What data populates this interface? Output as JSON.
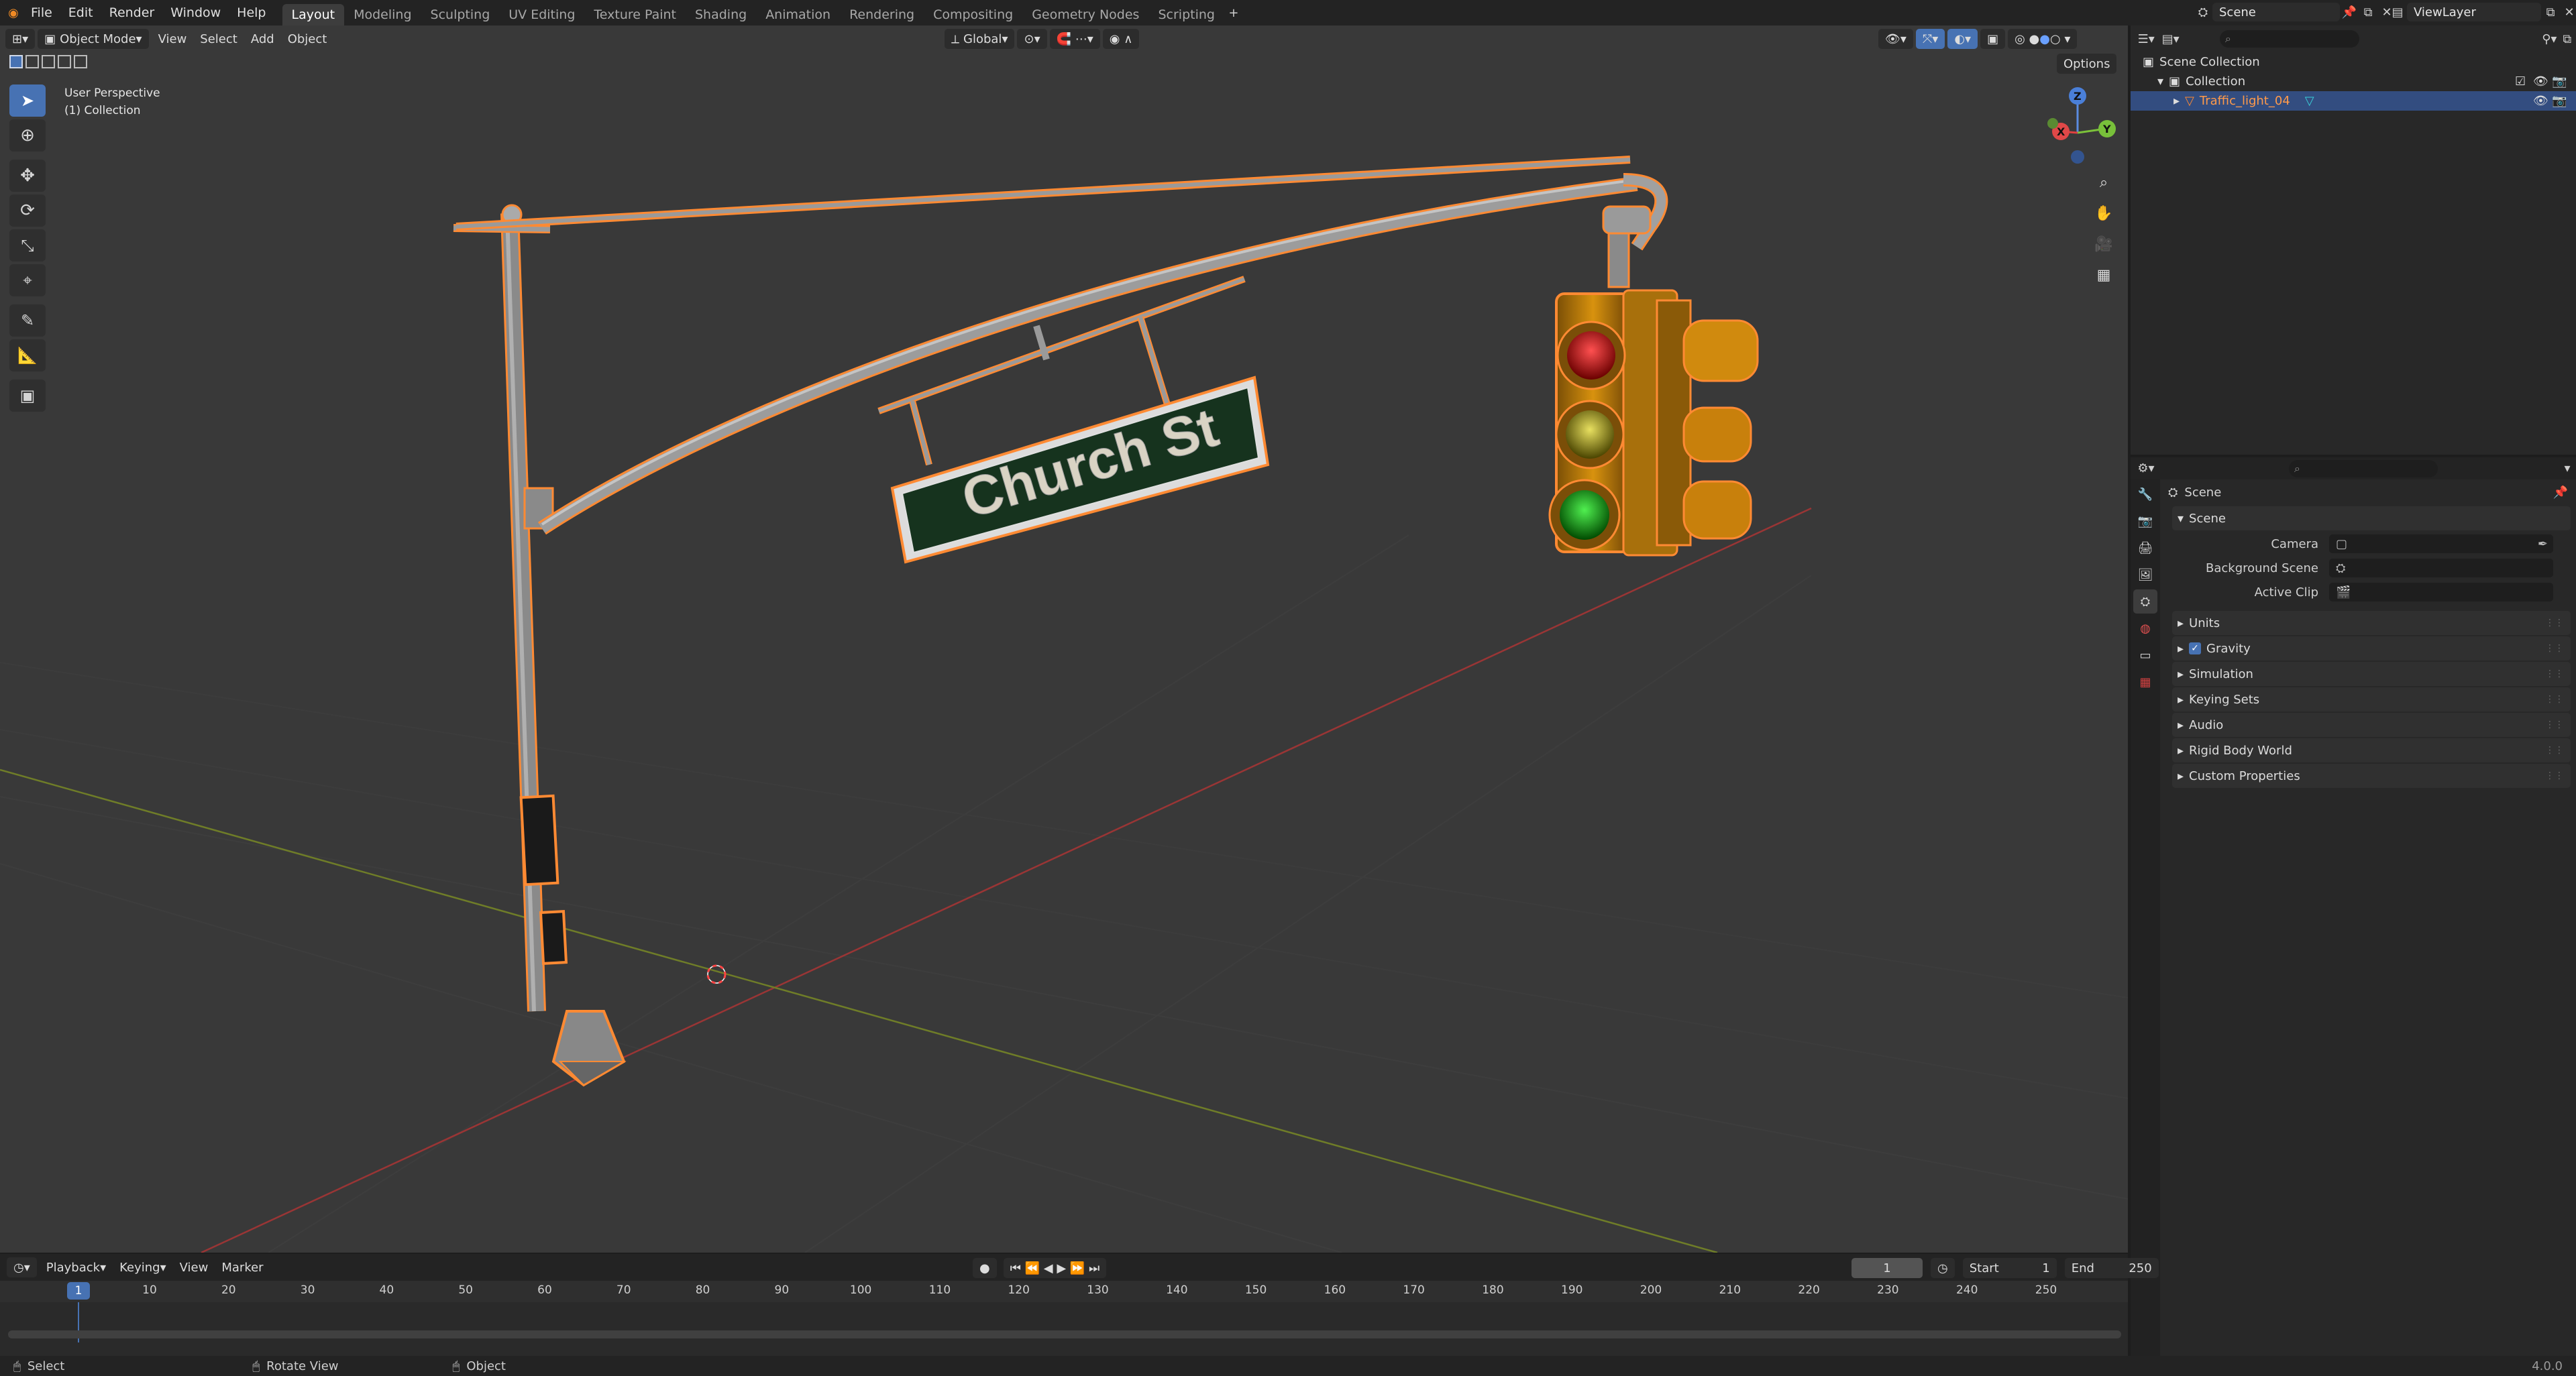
{
  "app": {
    "version": "4.0.0"
  },
  "menu": [
    "File",
    "Edit",
    "Render",
    "Window",
    "Help"
  ],
  "workspaces": [
    {
      "label": "Layout",
      "active": true
    },
    {
      "label": "Modeling"
    },
    {
      "label": "Sculpting"
    },
    {
      "label": "UV Editing"
    },
    {
      "label": "Texture Paint"
    },
    {
      "label": "Shading"
    },
    {
      "label": "Animation"
    },
    {
      "label": "Rendering"
    },
    {
      "label": "Compositing"
    },
    {
      "label": "Geometry Nodes"
    },
    {
      "label": "Scripting"
    }
  ],
  "scene_selector": {
    "value": "Scene"
  },
  "viewlayer_selector": {
    "value": "ViewLayer"
  },
  "viewport": {
    "mode": "Object Mode",
    "menus": [
      "View",
      "Select",
      "Add",
      "Object"
    ],
    "transform_orientation": "Global",
    "options_label": "Options",
    "overlay_text": {
      "perspective": "User Perspective",
      "collection": "(1) Collection"
    },
    "sign_text": "Church St",
    "gizmo_axes": {
      "z": "Z",
      "y": "Y",
      "x": "X"
    },
    "colors": {
      "selection": "#ff8a33",
      "grid_x": "#a03636",
      "grid_y": "#7a8a2a",
      "red_lamp": "#e02020",
      "yellow_lamp": "#c8c020",
      "green_lamp": "#20c020",
      "housing": "#c8820e"
    }
  },
  "outliner": {
    "items": [
      {
        "label": "Scene Collection"
      },
      {
        "label": "Collection"
      },
      {
        "label": "Traffic_light_04"
      }
    ]
  },
  "properties": {
    "title": "Scene",
    "panel_scene": "Scene",
    "fields": [
      {
        "label": "Camera"
      },
      {
        "label": "Background Scene"
      },
      {
        "label": "Active Clip"
      }
    ],
    "panels": [
      "Units",
      "Gravity",
      "Simulation",
      "Keying Sets",
      "Audio",
      "Rigid Body World",
      "Custom Properties"
    ]
  },
  "timeline": {
    "menus": [
      "Playback",
      "Keying",
      "View",
      "Marker"
    ],
    "current_frame": "1",
    "start_label": "Start",
    "start_value": "1",
    "end_label": "End",
    "end_value": "250",
    "ticks": [
      "10",
      "20",
      "30",
      "40",
      "50",
      "60",
      "70",
      "80",
      "90",
      "100",
      "110",
      "120",
      "130",
      "140",
      "150",
      "160",
      "170",
      "180",
      "190",
      "200",
      "210",
      "220",
      "230",
      "240",
      "250"
    ],
    "playhead": "1"
  },
  "statusbar": {
    "select": "Select",
    "rotate": "Rotate View",
    "object": "Object"
  }
}
